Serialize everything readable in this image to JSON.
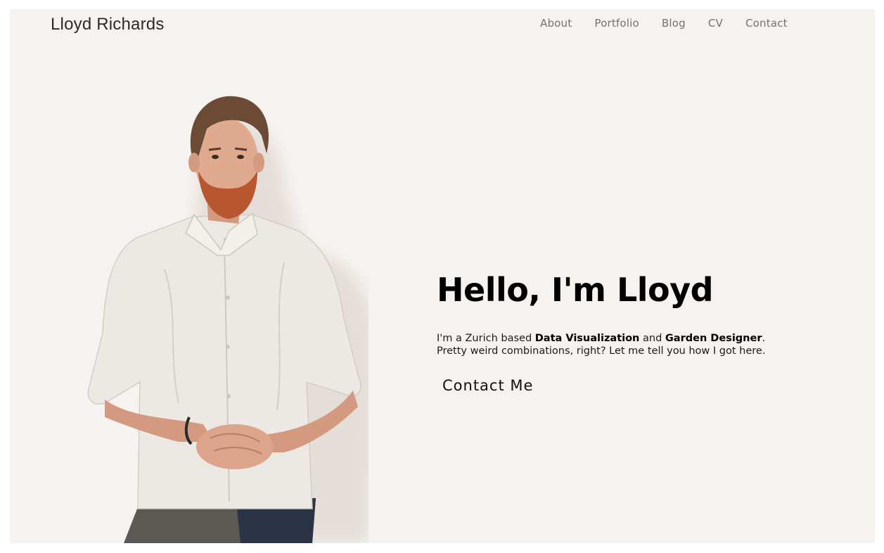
{
  "header": {
    "brand": "Lloyd Richards",
    "nav": [
      "About",
      "Portfolio",
      "Blog",
      "CV",
      "Contact"
    ]
  },
  "hero": {
    "title": "Hello, I'm Lloyd",
    "desc_part1": "I'm a Zurich based ",
    "desc_bold1": "Data Visualization",
    "desc_part2": " and ",
    "desc_bold2": "Garden Designer",
    "desc_part3": ".",
    "desc_line2": "Pretty weird combinations, right? Let me tell you how I got here.",
    "cta_label": "Contact Me"
  },
  "colors": {
    "background": "#f6f2ef",
    "nav_text": "#7a7068",
    "heading": "#000000"
  }
}
